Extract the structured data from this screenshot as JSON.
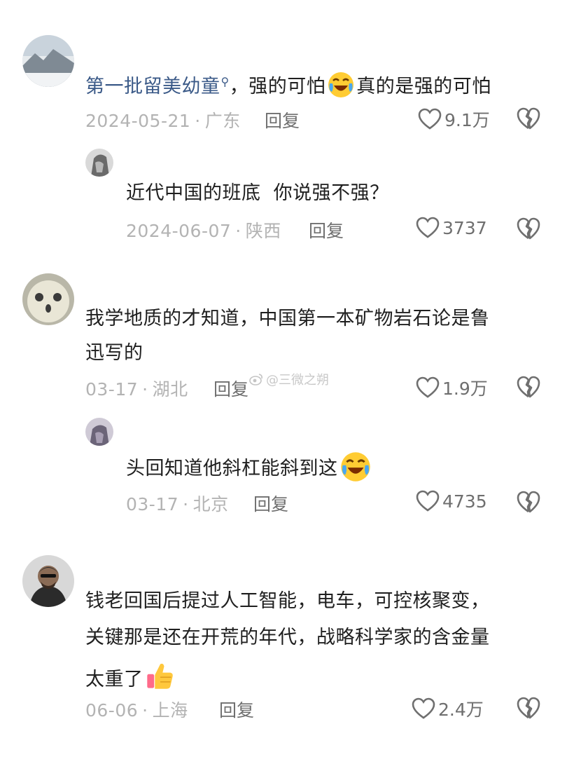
{
  "comments": [
    {
      "user_tag": "第一批留美幼童",
      "text_after": "，强的可怕",
      "text_tail": "真的是强的可怕",
      "date": "2024-05-21",
      "location": "广东",
      "reply_label": "回复",
      "likes": "9.1万",
      "emoji": "laughing-crying-emoji"
    },
    {
      "text": "近代中国的班底  你说强不强？",
      "date": "2024-06-07",
      "location": "陕西",
      "reply_label": "回复",
      "likes": "3737"
    },
    {
      "line1": "我学地质的才知道，中国第一本矿物岩石论是鲁",
      "line2": "迅写的",
      "date": "03-17",
      "location": "湖北",
      "reply_label": "回复",
      "likes": "1.9万"
    },
    {
      "text": "头回知道他斜杠能斜到这",
      "emoji": "laughing-crying-emoji",
      "date": "03-17",
      "location": "北京",
      "reply_label": "回复",
      "likes": "4735"
    },
    {
      "line1": "钱老回国后提过人工智能，电车，可控核聚变，",
      "line2": "关键那是还在开荒的年代，战略科学家的含金量",
      "line3": "太重了",
      "emoji": "thumbs-up-emoji",
      "date": "06-06",
      "location": "上海",
      "reply_label": "回复",
      "likes": "2.4万"
    }
  ],
  "watermark": {
    "text": "@三微之朔",
    "icon": "weibo-icon"
  },
  "colors": {
    "user_tag": "#3b5a88",
    "meta": "#b3b3b3",
    "action": "#6f6f6f",
    "text": "#1f1f1f"
  }
}
